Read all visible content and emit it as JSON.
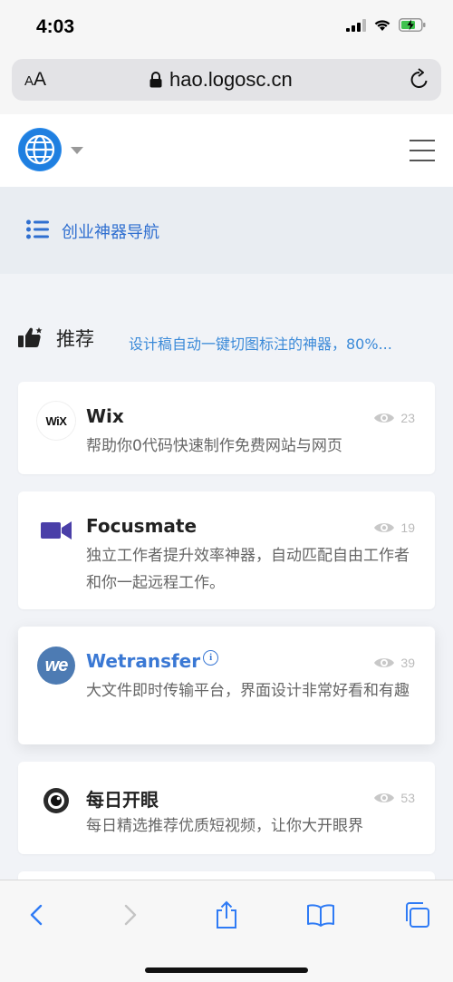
{
  "status_bar": {
    "time": "4:03"
  },
  "browser": {
    "text_size_label_big": "A",
    "text_size_label_small": "A",
    "url": "hao.logosc.cn"
  },
  "site": {
    "category_nav_label": "创业神器导航",
    "section_title": "推荐",
    "section_desc": "设计稿自动一键切图标注的神器，80%..."
  },
  "cards": [
    {
      "title": "Wix",
      "desc": "帮助你0代码快速制作免费网站与网页",
      "views": "23",
      "thumb_text": "WiX"
    },
    {
      "title": "Focusmate",
      "desc": "独立工作者提升效率神器，自动匹配自由工作者和你一起远程工作。",
      "views": "19"
    },
    {
      "title": "Wetransfer",
      "desc": "大文件即时传输平台，界面设计非常好看和有趣",
      "views": "39",
      "thumb_text": "we"
    },
    {
      "title": "每日开眼",
      "desc": "每日精选推荐优质短视频，让你大开眼界",
      "views": "53"
    }
  ],
  "colors": {
    "accent": "#3a78d4",
    "link": "#3b8ad8",
    "ios_blue": "#2f7bf5"
  }
}
